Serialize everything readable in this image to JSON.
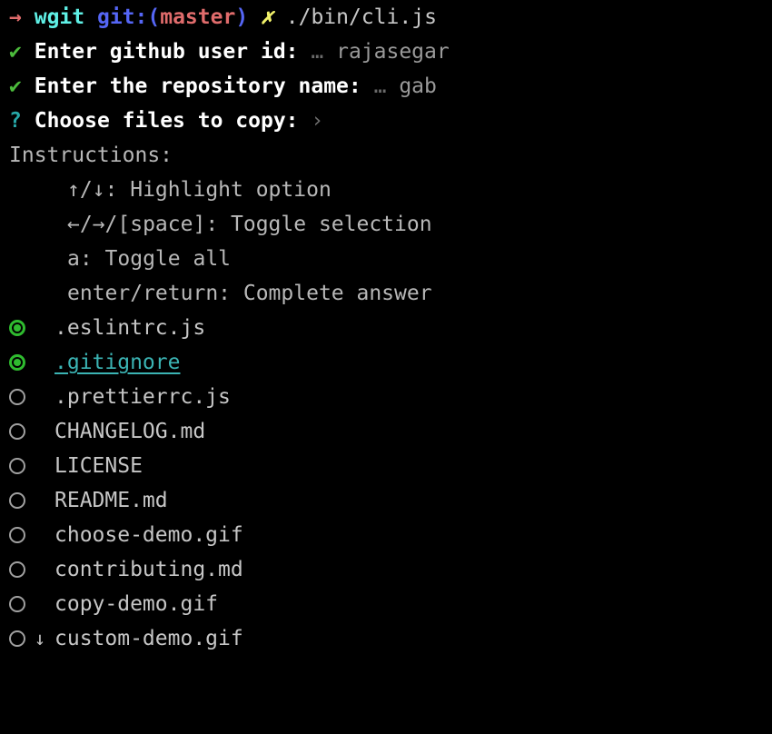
{
  "theme": {
    "background": "#000000",
    "foreground": "#d0d0d0",
    "accent_selected": "#2fbb2f",
    "accent_highlight": "#3bb4b4",
    "prompt_arrow": "#e06c6c",
    "prompt_cwd": "#5ff0e6",
    "prompt_git": "#5566f5",
    "prompt_branch": "#e06c6c",
    "prompt_status": "#f2f26a",
    "dim": "#6a6a6a",
    "check": "#4cbb3c",
    "question": "#27a8a8"
  },
  "prompt": {
    "arrow": "→",
    "cwd": "wgit",
    "git_keyword": "git:",
    "paren_open": "(",
    "branch": "master",
    "paren_close": ")",
    "status_symbol": "✗",
    "command": "./bin/cli.js"
  },
  "answered": [
    {
      "symbol": "✔",
      "question": "Enter github user id:",
      "separator": "…",
      "answer": "rajasegar"
    },
    {
      "symbol": "✔",
      "question": "Enter the repository name:",
      "separator": "…",
      "answer": "gab"
    }
  ],
  "active_prompt": {
    "symbol": "?",
    "question": "Choose files to copy:",
    "chevron": "›"
  },
  "instructions": {
    "heading": "Instructions:",
    "items": [
      "↑/↓: Highlight option",
      "←/→/[space]: Toggle selection",
      "a: Toggle all",
      "enter/return: Complete answer"
    ]
  },
  "choices": [
    {
      "label": ".eslintrc.js",
      "selected": true,
      "active": false,
      "scroll": ""
    },
    {
      "label": ".gitignore",
      "selected": true,
      "active": true,
      "scroll": ""
    },
    {
      "label": ".prettierrc.js",
      "selected": false,
      "active": false,
      "scroll": ""
    },
    {
      "label": "CHANGELOG.md",
      "selected": false,
      "active": false,
      "scroll": ""
    },
    {
      "label": "LICENSE",
      "selected": false,
      "active": false,
      "scroll": ""
    },
    {
      "label": "README.md",
      "selected": false,
      "active": false,
      "scroll": ""
    },
    {
      "label": "choose-demo.gif",
      "selected": false,
      "active": false,
      "scroll": ""
    },
    {
      "label": "contributing.md",
      "selected": false,
      "active": false,
      "scroll": ""
    },
    {
      "label": "copy-demo.gif",
      "selected": false,
      "active": false,
      "scroll": ""
    },
    {
      "label": "custom-demo.gif",
      "selected": false,
      "active": false,
      "scroll": "↓"
    }
  ]
}
